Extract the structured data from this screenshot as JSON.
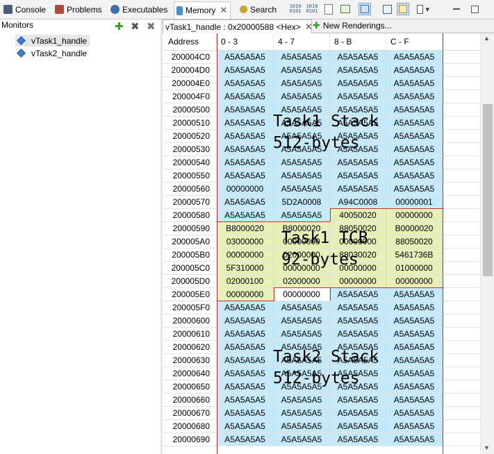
{
  "toolbar": {
    "tabs": [
      {
        "label": "Console",
        "icon": "console-icon",
        "color": "#4a5c7a"
      },
      {
        "label": "Problems",
        "icon": "problems-icon",
        "color": "#b24a3a"
      },
      {
        "label": "Executables",
        "icon": "executables-icon",
        "color": "#3a6fb2"
      },
      {
        "label": "Memory",
        "icon": "memory-icon",
        "color": "#4b8fd0",
        "active": true
      },
      {
        "label": "Search",
        "icon": "search-icon",
        "color": "#c9a227"
      }
    ],
    "memory_tab_close": "✕",
    "bits_top": "1010",
    "bits_bottom": "0101",
    "menu_arrow": "▾"
  },
  "monitors": {
    "title": "Monitors",
    "add_label": "✚",
    "remove_label": "✖",
    "remove_all_label": "✖",
    "items": [
      {
        "label": "vTask1_handle",
        "selected": true
      },
      {
        "label": "vTask2_handle",
        "selected": false
      }
    ]
  },
  "renderings": {
    "active_tab": "vTask1_handle : 0x20000588 <Hex>",
    "active_tab_close": "✕",
    "new_tab": "New Renderings...",
    "new_tab_icon": "✚"
  },
  "table": {
    "columns": [
      "Address",
      "0 - 3",
      "4 - 7",
      "8 - B",
      "C - F"
    ],
    "rows": [
      {
        "addr": "200004C0",
        "cells": [
          "A5A5A5A5",
          "A5A5A5A5",
          "A5A5A5A5",
          "A5A5A5A5"
        ],
        "fill": [
          "stack",
          "stack",
          "stack",
          "stack"
        ]
      },
      {
        "addr": "200004D0",
        "cells": [
          "A5A5A5A5",
          "A5A5A5A5",
          "A5A5A5A5",
          "A5A5A5A5"
        ],
        "fill": [
          "stack",
          "stack",
          "stack",
          "stack"
        ]
      },
      {
        "addr": "200004E0",
        "cells": [
          "A5A5A5A5",
          "A5A5A5A5",
          "A5A5A5A5",
          "A5A5A5A5"
        ],
        "fill": [
          "stack",
          "stack",
          "stack",
          "stack"
        ]
      },
      {
        "addr": "200004F0",
        "cells": [
          "A5A5A5A5",
          "A5A5A5A5",
          "A5A5A5A5",
          "A5A5A5A5"
        ],
        "fill": [
          "stack",
          "stack",
          "stack",
          "stack"
        ]
      },
      {
        "addr": "20000500",
        "cells": [
          "A5A5A5A5",
          "A5A5A5A5",
          "A5A5A5A5",
          "A5A5A5A5"
        ],
        "fill": [
          "stack",
          "stack",
          "stack",
          "stack"
        ]
      },
      {
        "addr": "20000510",
        "cells": [
          "A5A5A5A5",
          "A5A5A5A5",
          "A5A5A5A5",
          "A5A5A5A5"
        ],
        "fill": [
          "stack",
          "stack",
          "stack",
          "stack"
        ]
      },
      {
        "addr": "20000520",
        "cells": [
          "A5A5A5A5",
          "A5A5A5A5",
          "A5A5A5A5",
          "A5A5A5A5"
        ],
        "fill": [
          "stack",
          "stack",
          "stack",
          "stack"
        ]
      },
      {
        "addr": "20000530",
        "cells": [
          "A5A5A5A5",
          "A5A5A5A5",
          "A5A5A5A5",
          "A5A5A5A5"
        ],
        "fill": [
          "stack",
          "stack",
          "stack",
          "stack"
        ]
      },
      {
        "addr": "20000540",
        "cells": [
          "A5A5A5A5",
          "A5A5A5A5",
          "A5A5A5A5",
          "A5A5A5A5"
        ],
        "fill": [
          "stack",
          "stack",
          "stack",
          "stack"
        ]
      },
      {
        "addr": "20000550",
        "cells": [
          "A5A5A5A5",
          "A5A5A5A5",
          "A5A5A5A5",
          "A5A5A5A5"
        ],
        "fill": [
          "stack",
          "stack",
          "stack",
          "stack"
        ]
      },
      {
        "addr": "20000560",
        "cells": [
          "00000000",
          "A5A5A5A5",
          "A5A5A5A5",
          "A5A5A5A5"
        ],
        "fill": [
          "stack",
          "stack",
          "stack",
          "stack"
        ]
      },
      {
        "addr": "20000570",
        "cells": [
          "A5A5A5A5",
          "5D2A0008",
          "A94C0008",
          "00000001"
        ],
        "fill": [
          "stack",
          "stack",
          "stack",
          "stack"
        ]
      },
      {
        "addr": "20000580",
        "cells": [
          "A5A5A5A5",
          "A5A5A5A5",
          "40050020",
          "00000000"
        ],
        "fill": [
          "stack",
          "stack",
          "tcb",
          "tcb"
        ]
      },
      {
        "addr": "20000590",
        "cells": [
          "B8000020",
          "B8000020",
          "88050020",
          "B0000020"
        ],
        "fill": [
          "tcb",
          "tcb",
          "tcb",
          "tcb"
        ]
      },
      {
        "addr": "200005A0",
        "cells": [
          "03000000",
          "00000000",
          "00000000",
          "88050020"
        ],
        "fill": [
          "tcb",
          "tcb",
          "tcb",
          "tcb"
        ]
      },
      {
        "addr": "200005B0",
        "cells": [
          "00000000",
          "02000000",
          "88030020",
          "5461736B"
        ],
        "fill": [
          "tcb",
          "tcb",
          "tcb",
          "tcb"
        ]
      },
      {
        "addr": "200005C0",
        "cells": [
          "5F310000",
          "00000000",
          "00000000",
          "01000000"
        ],
        "fill": [
          "tcb",
          "tcb",
          "tcb",
          "tcb"
        ]
      },
      {
        "addr": "200005D0",
        "cells": [
          "02000100",
          "02000000",
          "00000000",
          "00000000"
        ],
        "fill": [
          "tcb",
          "tcb",
          "tcb",
          "tcb"
        ]
      },
      {
        "addr": "200005E0",
        "cells": [
          "00000000",
          "00000000",
          "A5A5A5A5",
          "A5A5A5A5"
        ],
        "fill": [
          "tcb",
          "free",
          "stack",
          "stack"
        ]
      },
      {
        "addr": "200005F0",
        "cells": [
          "A5A5A5A5",
          "A5A5A5A5",
          "A5A5A5A5",
          "A5A5A5A5"
        ],
        "fill": [
          "stack",
          "stack",
          "stack",
          "stack"
        ]
      },
      {
        "addr": "20000600",
        "cells": [
          "A5A5A5A5",
          "A5A5A5A5",
          "A5A5A5A5",
          "A5A5A5A5"
        ],
        "fill": [
          "stack",
          "stack",
          "stack",
          "stack"
        ]
      },
      {
        "addr": "20000610",
        "cells": [
          "A5A5A5A5",
          "A5A5A5A5",
          "A5A5A5A5",
          "A5A5A5A5"
        ],
        "fill": [
          "stack",
          "stack",
          "stack",
          "stack"
        ]
      },
      {
        "addr": "20000620",
        "cells": [
          "A5A5A5A5",
          "A5A5A5A5",
          "A5A5A5A5",
          "A5A5A5A5"
        ],
        "fill": [
          "stack",
          "stack",
          "stack",
          "stack"
        ]
      },
      {
        "addr": "20000630",
        "cells": [
          "A5A5A5A5",
          "A5A5A5A5",
          "A5A5A5A5",
          "A5A5A5A5"
        ],
        "fill": [
          "stack",
          "stack",
          "stack",
          "stack"
        ]
      },
      {
        "addr": "20000640",
        "cells": [
          "A5A5A5A5",
          "A5A5A5A5",
          "A5A5A5A5",
          "A5A5A5A5"
        ],
        "fill": [
          "stack",
          "stack",
          "stack",
          "stack"
        ]
      },
      {
        "addr": "20000650",
        "cells": [
          "A5A5A5A5",
          "A5A5A5A5",
          "A5A5A5A5",
          "A5A5A5A5"
        ],
        "fill": [
          "stack",
          "stack",
          "stack",
          "stack"
        ]
      },
      {
        "addr": "20000660",
        "cells": [
          "A5A5A5A5",
          "A5A5A5A5",
          "A5A5A5A5",
          "A5A5A5A5"
        ],
        "fill": [
          "stack",
          "stack",
          "stack",
          "stack"
        ]
      },
      {
        "addr": "20000670",
        "cells": [
          "A5A5A5A5",
          "A5A5A5A5",
          "A5A5A5A5",
          "A5A5A5A5"
        ],
        "fill": [
          "stack",
          "stack",
          "stack",
          "stack"
        ]
      },
      {
        "addr": "20000680",
        "cells": [
          "A5A5A5A5",
          "A5A5A5A5",
          "A5A5A5A5",
          "A5A5A5A5"
        ],
        "fill": [
          "stack",
          "stack",
          "stack",
          "stack"
        ]
      },
      {
        "addr": "20000690",
        "cells": [
          "A5A5A5A5",
          "A5A5A5A5",
          "A5A5A5A5",
          "A5A5A5A5"
        ],
        "fill": [
          "stack",
          "stack",
          "stack",
          "stack"
        ]
      }
    ]
  },
  "annotations": {
    "task1_stack_line1": "Task1 Stack",
    "task1_stack_line2": "512-bytes",
    "task1_tcb_line1": "Task1 TCB",
    "task1_tcb_line2": "92-bytes",
    "task2_stack_line1": "Task2 Stack",
    "task2_stack_line2": "512-bytes"
  },
  "colors": {
    "stack_fill": "#c4eafa",
    "tcb_fill": "#e6efb6",
    "outline": "#d9262f"
  }
}
